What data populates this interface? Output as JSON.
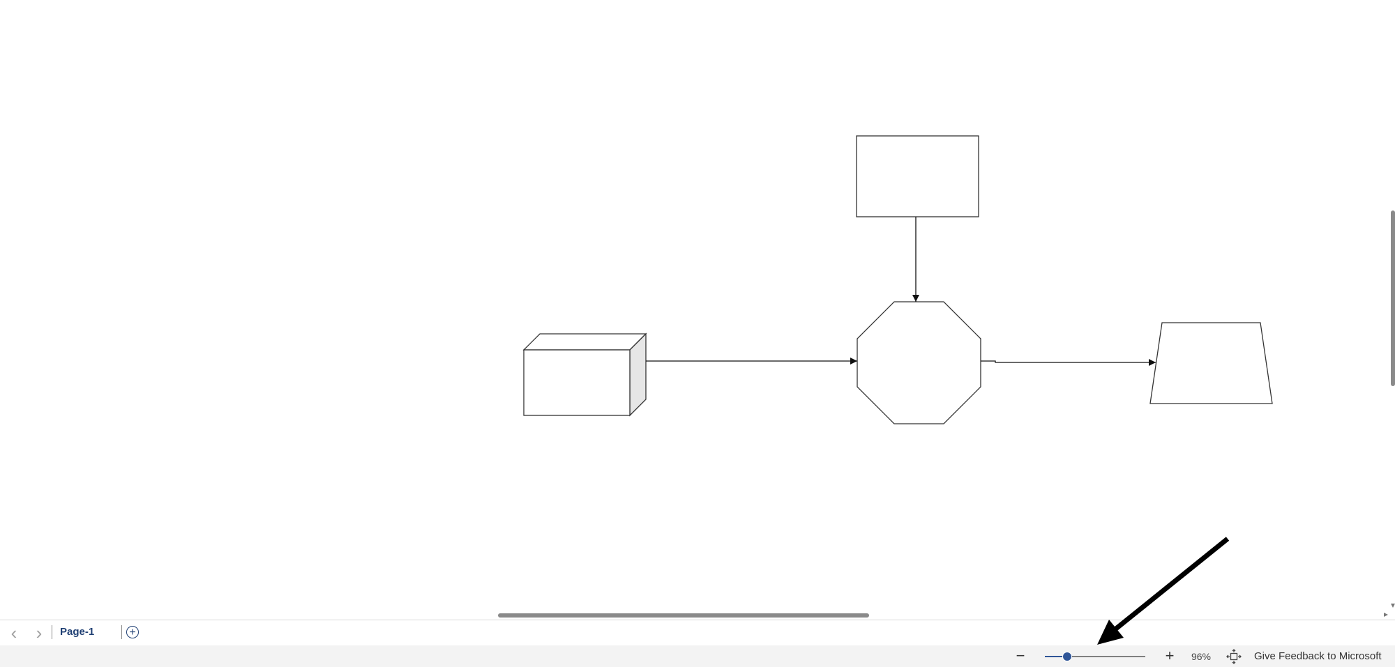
{
  "page_tabs": {
    "prev_icon": "chevron-left-icon",
    "next_icon": "chevron-right-icon",
    "current_page": "Page-1",
    "add_icon": "plus-circle-icon"
  },
  "status_bar": {
    "zoom_out_icon": "minus-icon",
    "zoom_in_icon": "plus-icon",
    "zoom_level": "96%",
    "zoom_slider_fraction": 0.22,
    "fit_icon": "fit-to-window-icon",
    "feedback": "Give Feedback to Microsoft"
  },
  "colors": {
    "accent": "#2f5597",
    "tab_text": "#1f3f73",
    "status_bg": "#f3f3f3",
    "shape_stroke": "#333333",
    "cube_side_fill": "#e6e6e6",
    "annotation_arrow": "#000000"
  }
}
